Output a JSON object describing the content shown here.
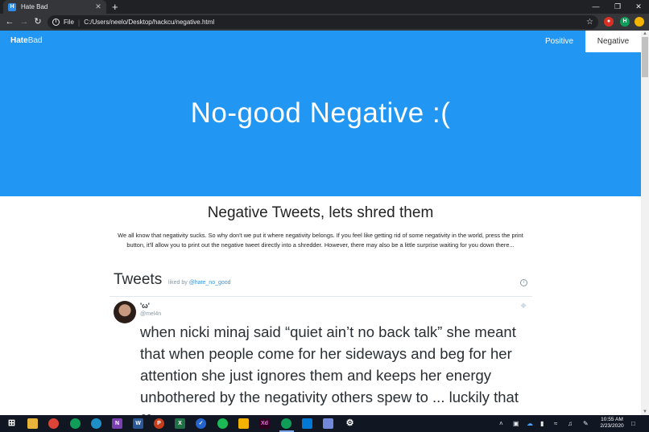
{
  "browser": {
    "tab_title": "Hate Bad",
    "tab_close": "✕",
    "new_tab": "+",
    "window_controls": [
      "—",
      "❐",
      "✕"
    ],
    "address_prefix": "File",
    "url": "C:/Users/neelo/Desktop/hackcu/negative.html",
    "extension_avatar": "H"
  },
  "nav": {
    "brand_bold": "Hate",
    "brand_light": "Bad",
    "positive": "Positive",
    "negative": "Negative"
  },
  "hero": {
    "title": "No-good Negative :("
  },
  "section": {
    "title": "Negative Tweets, lets shred them",
    "description": "We all know that negativity sucks. So why don't we put it where negativity belongs. If you feel like getting rid of some negativity in the world, press the print button, it'll allow you to print out the negative tweet directly into a shredder. However, there may also be a little surprise waiting for you down there..."
  },
  "timeline": {
    "title": "Tweets",
    "liked_by": "liked by",
    "liked_handle": "@hate_no_good",
    "tweet": {
      "name": "'ω'",
      "handle": "@mel4n",
      "text": "when nicki minaj said “quiet ain’t no back talk” she meant that when people come for her sideways and beg for her attention she just ignores them and keeps her energy unbothered by the negativity others spew to ... luckily that ❤"
    }
  },
  "taskbar": {
    "time": "10:55 AM",
    "date": "2/23/2020"
  },
  "colors": {
    "primary": "#2196f3",
    "browser_dark": "#202124",
    "taskbar": "#101622"
  }
}
